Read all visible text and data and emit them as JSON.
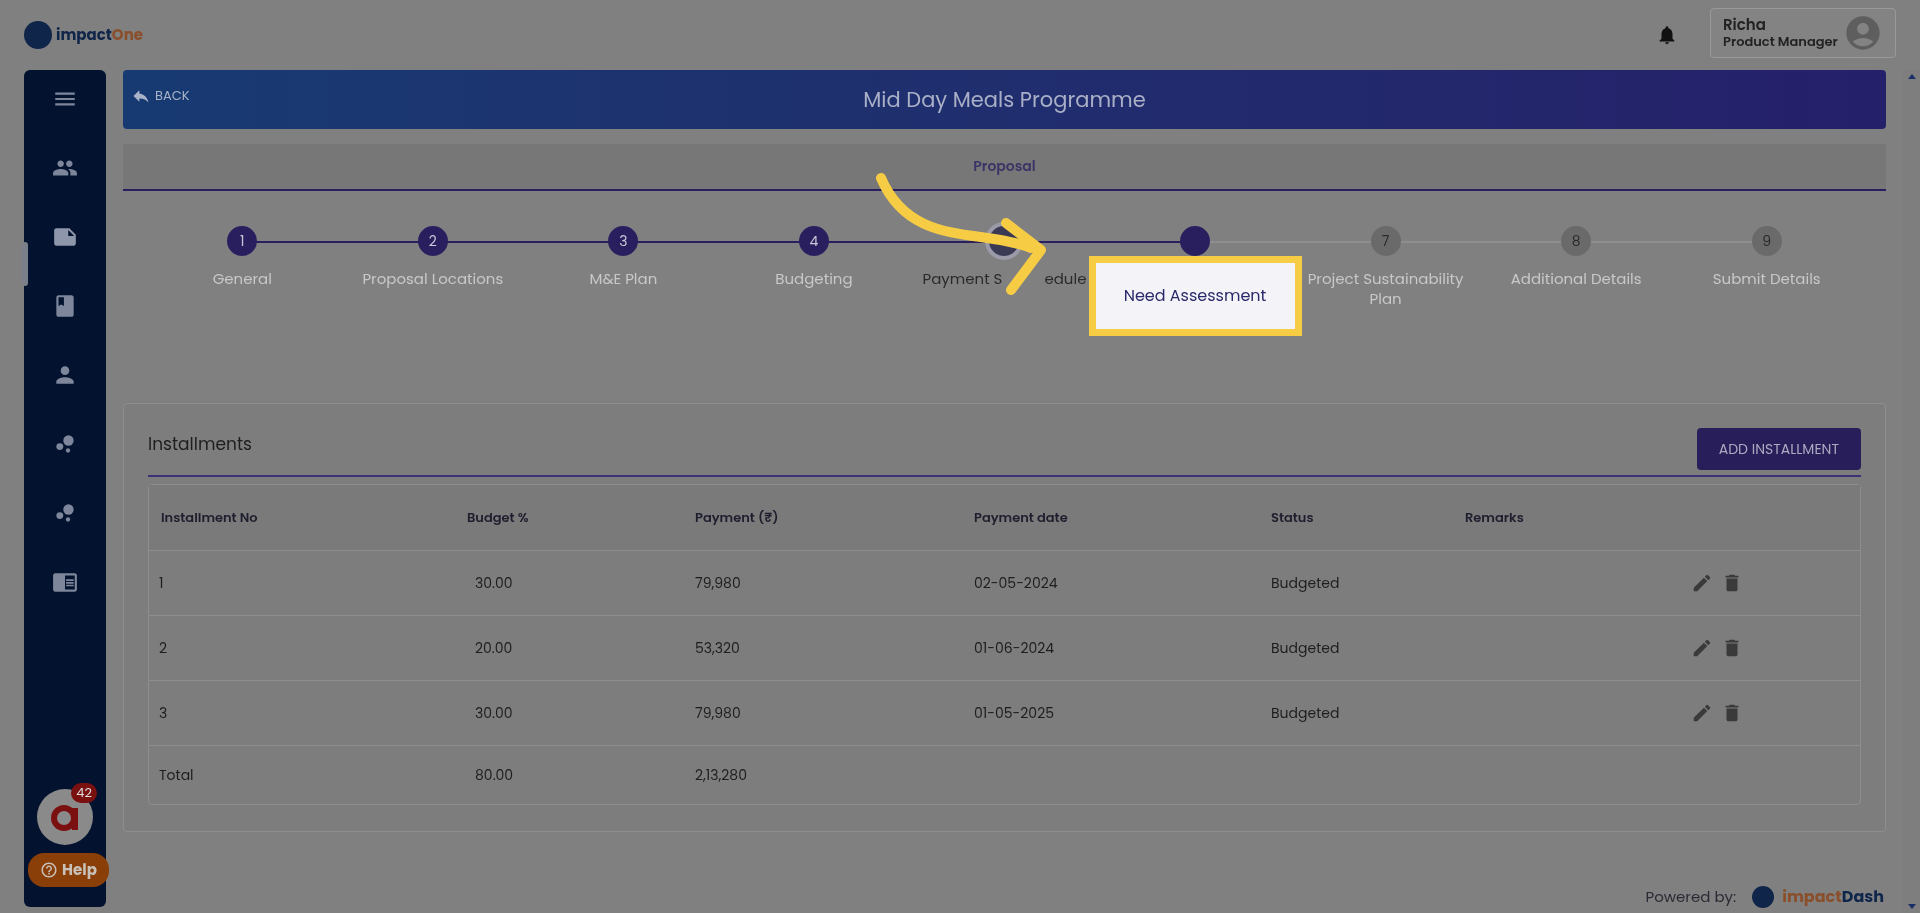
{
  "brand": {
    "name_first": "impact",
    "name_second": "One"
  },
  "user": {
    "name": "Richa",
    "role": "Product Manager"
  },
  "sidebar": {
    "items": [
      {
        "kind": "menu"
      },
      {
        "kind": "people"
      },
      {
        "kind": "note",
        "selected": true
      },
      {
        "kind": "book"
      },
      {
        "kind": "person"
      },
      {
        "kind": "dots"
      },
      {
        "kind": "dots"
      },
      {
        "kind": "reader"
      }
    ],
    "badge": "42",
    "help": "Help"
  },
  "header": {
    "back": "BACK",
    "title": "Mid Day Meals Programme"
  },
  "tab": "Proposal",
  "steps": [
    {
      "number": "1",
      "label": "General",
      "kind": "done",
      "highlighted": false
    },
    {
      "number": "2",
      "label": "Proposal Locations",
      "kind": "done",
      "highlighted": false
    },
    {
      "number": "3",
      "label": "M&E Plan",
      "kind": "done",
      "highlighted": false
    },
    {
      "number": "4",
      "label": "Budgeting",
      "kind": "done",
      "highlighted": false
    },
    {
      "label": "Payment S",
      "label_rest": "edule",
      "kind": "current",
      "highlighted": false
    },
    {
      "label": "Need Assessment",
      "kind": "done",
      "highlighted": true
    },
    {
      "number": "7",
      "label": "Project Sustainability Plan",
      "kind": "upcoming",
      "highlighted": false
    },
    {
      "number": "8",
      "label": "Additional Details",
      "kind": "upcoming",
      "highlighted": false
    },
    {
      "number": "9",
      "label": "Submit Details",
      "kind": "upcoming",
      "highlighted": false
    }
  ],
  "installments": {
    "title": "Installments",
    "add_button": "ADD INSTALLMENT",
    "columns": [
      "Installment No",
      "Budget %",
      "Payment (₹)",
      "Payment date",
      "Status",
      "Remarks"
    ],
    "rows": [
      {
        "no": "1",
        "budget": "30.00",
        "payment": "79,980",
        "date": "02-05-2024",
        "status": "Budgeted"
      },
      {
        "no": "2",
        "budget": "20.00",
        "payment": "53,320",
        "date": "01-06-2024",
        "status": "Budgeted"
      },
      {
        "no": "3",
        "budget": "30.00",
        "payment": "79,980",
        "date": "01-05-2025",
        "status": "Budgeted"
      }
    ],
    "total": {
      "label": "Total",
      "budget": "80.00",
      "payment": "2,13,280"
    }
  },
  "footer": {
    "powered_by": "Powered by:",
    "brand_first": "impact",
    "brand_second": "Dash"
  }
}
